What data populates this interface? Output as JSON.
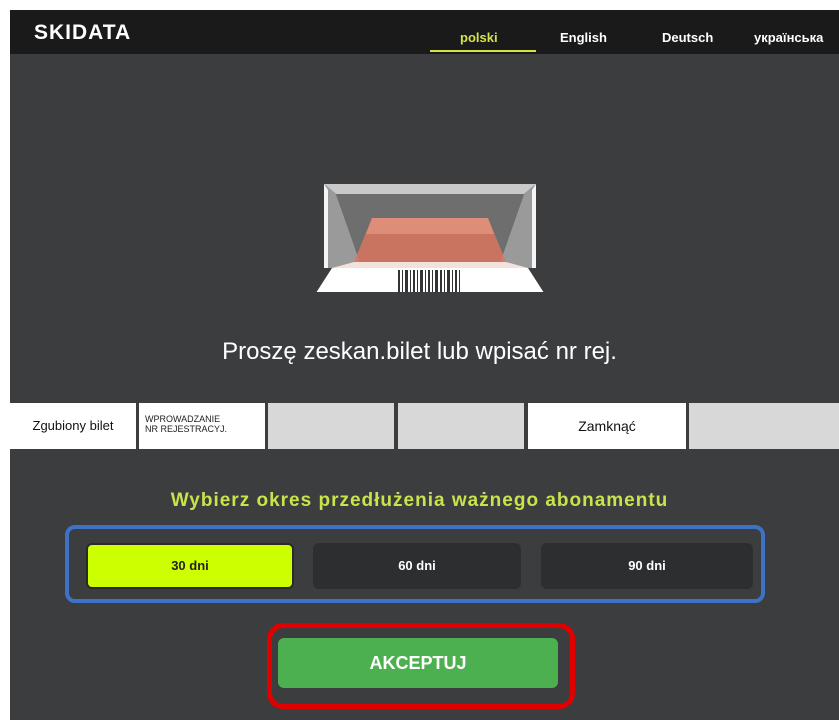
{
  "header": {
    "logo": "SKIDATA",
    "languages": [
      {
        "label": "polski",
        "selected": true
      },
      {
        "label": "English",
        "selected": false
      },
      {
        "label": "Deutsch",
        "selected": false
      },
      {
        "label": "українська",
        "selected": false
      }
    ],
    "accent_color": "#d6e24a"
  },
  "scanner_icon": "barcode-scanner-icon",
  "prompt": "Proszę zeskan.bilet lub wpisać nr rej.",
  "function_buttons": {
    "lost_ticket": "Zgubiony bilet",
    "registration_line1": "WPROWADZANIE",
    "registration_line2": "NR REJESTRACYJ.",
    "close": "Zamknąć"
  },
  "period": {
    "title": "Wybierz okres przedłużenia ważnego abonamentu",
    "options": [
      {
        "label": "30 dni",
        "selected": true
      },
      {
        "label": "60 dni",
        "selected": false
      },
      {
        "label": "90 dni",
        "selected": false
      }
    ],
    "selected_color": "#ccff00",
    "highlight_color": "#3d72c6"
  },
  "accept": {
    "label": "AKCEPTUJ",
    "color": "#4caf50",
    "highlight_color": "#e00000"
  }
}
